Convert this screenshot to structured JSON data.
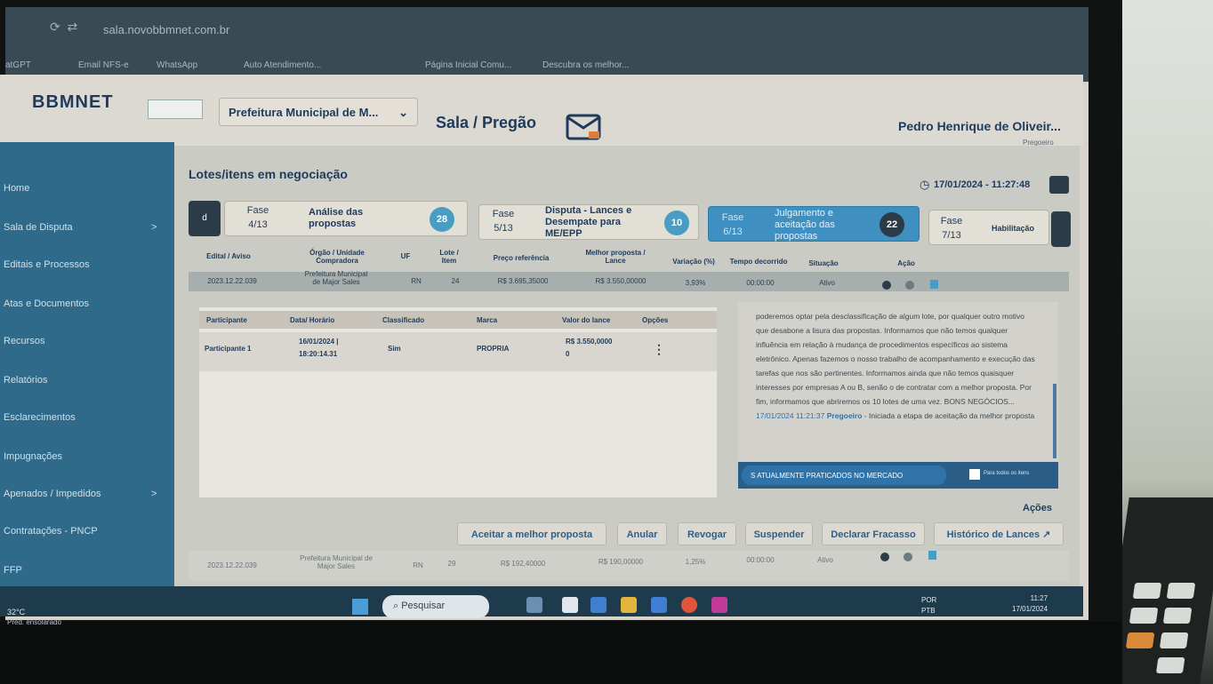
{
  "browser": {
    "url": "sala.novobbmnet.com.br",
    "bookmarks": [
      "atGPT",
      "Email NFS-e",
      "WhatsApp",
      "Auto Atendimento...",
      "Página Inicial Comu...",
      "Descubra os melhor..."
    ]
  },
  "header": {
    "logo": "BBMNET",
    "org_select": "Prefeitura Municipal de M...",
    "room_title": "Sala / Pregão",
    "user_name": "Pedro Henrique de Oliveir...",
    "user_role": "Pregoeiro"
  },
  "sidebar": {
    "items": [
      {
        "label": "Home"
      },
      {
        "label": "Sala de Disputa",
        "chevron": ">"
      },
      {
        "label": "Editais e Processos"
      },
      {
        "label": "Atas e Documentos"
      },
      {
        "label": "Recursos"
      },
      {
        "label": "Relatórios"
      },
      {
        "label": "Esclarecimentos"
      },
      {
        "label": "Impugnações"
      },
      {
        "label": "Apenados / Impedidos",
        "chevron": ">"
      },
      {
        "label": "Contratações - PNCP"
      },
      {
        "label": "FFP"
      }
    ]
  },
  "main": {
    "section_title": "Lotes/itens em negociação",
    "datetime": "17/01/2024 - 11:27:48",
    "prev_label": "d",
    "phases": [
      {
        "label": "Fase",
        "number": "4/13",
        "name": "Análise das propostas",
        "count": "28"
      },
      {
        "label": "Fase",
        "number": "5/13",
        "name": "Disputa - Lances e Desempate para ME/EPP",
        "count": "10"
      },
      {
        "label": "Fase",
        "number": "6/13",
        "name": "Julgamento e aceitação das propostas",
        "count": "22"
      },
      {
        "label": "Fase",
        "number": "7/13",
        "name": "Habilitação",
        "count": ""
      }
    ],
    "lot_table": {
      "headers": [
        "Edital / Aviso",
        "Órgão / Unidade Compradora",
        "UF",
        "Lote / Item",
        "Preço referência",
        "Melhor proposta / Lance",
        "Variação (%)",
        "Tempo decorrido",
        "Situação",
        "Ação"
      ],
      "row": [
        "2023.12.22.039",
        "Prefeitura Municipal de Major Sales",
        "RN",
        "24",
        "R$ 3.695,35000",
        "R$ 3.550,00000",
        "3,93%",
        "00:00:00",
        "Ativo"
      ]
    },
    "participants": {
      "headers": [
        "Participante",
        "Data/ Horário",
        "Classificado",
        "Marca",
        "Valor do lance",
        "Opções"
      ],
      "rows": [
        {
          "participant": "Participante 1",
          "datetime": "16/01/2024 | 18:20:14.31",
          "classified": "Sim",
          "brand": "PROPRIA",
          "bid": "R$ 3.550,0000 0",
          "options": "⋮"
        }
      ]
    },
    "chat": {
      "text": "poderemos optar pela desclassificação de algum lote, por qualquer outro motivo que desabone a lisura das propostas. Informamos que não temos qualquer influência em relação à mudança de procedimentos específicos ao sistema eletrônico. Apenas fazemos o nosso trabalho de acompanhamento e execução das tarefas que nos são pertinentes. Informamos ainda que não temos quaisquer interesses por empresas A ou B, senão o de contratar com a melhor proposta. Por fim, informamos que abriremos os 10 lotes de uma vez. BONS NEGÓCIOS...",
      "time": "17/01/2024 11:21:37",
      "author": "Pregoeiro",
      "message": "- Iniciada a etapa de aceitação da melhor proposta",
      "input_value": "S ATUALMENTE PRATICADOS NO MERCADO",
      "checkbox_label": "Para todos os itens"
    },
    "actions": {
      "label": "Ações",
      "buttons": [
        "Aceitar a melhor proposta",
        "Anular",
        "Revogar",
        "Suspender",
        "Declarar Fracasso",
        "Histórico de Lances ↗"
      ]
    },
    "lot_row_2": [
      "2023.12.22.039",
      "Prefeitura Municipal de Major Sales",
      "RN",
      "29",
      "R$ 192,40000",
      "R$ 190,00000",
      "1,25%",
      "00:00:00",
      "Ativo"
    ]
  },
  "taskbar": {
    "temperature": "32°C",
    "weather": "Pred. ensolarado",
    "search": "Pesquisar",
    "lang": "POR",
    "lang2": "PTB",
    "time": "11:27",
    "date": "17/01/2024"
  },
  "colors": {
    "brand": "#1f3a5a",
    "sidebar": "#2f6a8a",
    "accent": "#4a9dc2"
  }
}
